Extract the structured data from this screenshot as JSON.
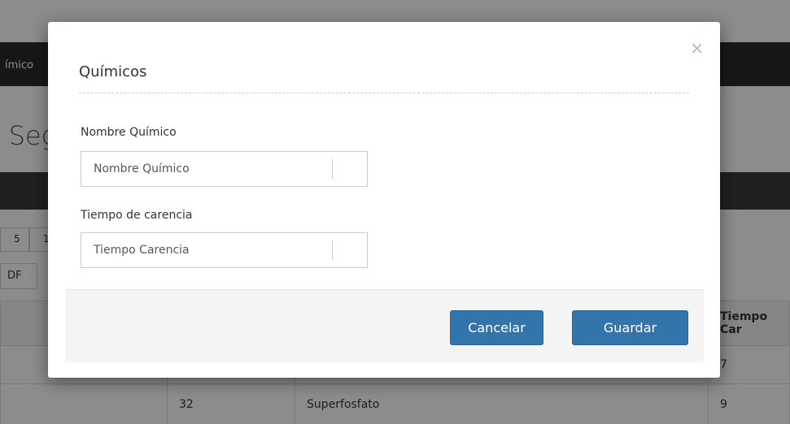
{
  "background": {
    "topnav_item": "ímico",
    "page_heading": ") Seg",
    "length_options": [
      "5",
      "1"
    ],
    "export_label": "DF",
    "table": {
      "headers": [
        "",
        "",
        "",
        "Tiempo Car"
      ],
      "rows": [
        [
          "",
          "",
          "",
          "7"
        ],
        [
          "",
          "32",
          "Superfosfato",
          "9"
        ]
      ]
    }
  },
  "modal": {
    "close_icon": "×",
    "title": "Químicos",
    "fields": {
      "nombre": {
        "label": "Nombre Químico",
        "placeholder": "Nombre Químico",
        "value": ""
      },
      "tiempo": {
        "label": "Tiempo de carencia",
        "placeholder": "Tiempo Carencia",
        "value": ""
      }
    },
    "buttons": {
      "cancel": "Cancelar",
      "save": "Guardar"
    },
    "colors": {
      "button": "#3275ad",
      "footer": "#f4f4f4"
    }
  }
}
